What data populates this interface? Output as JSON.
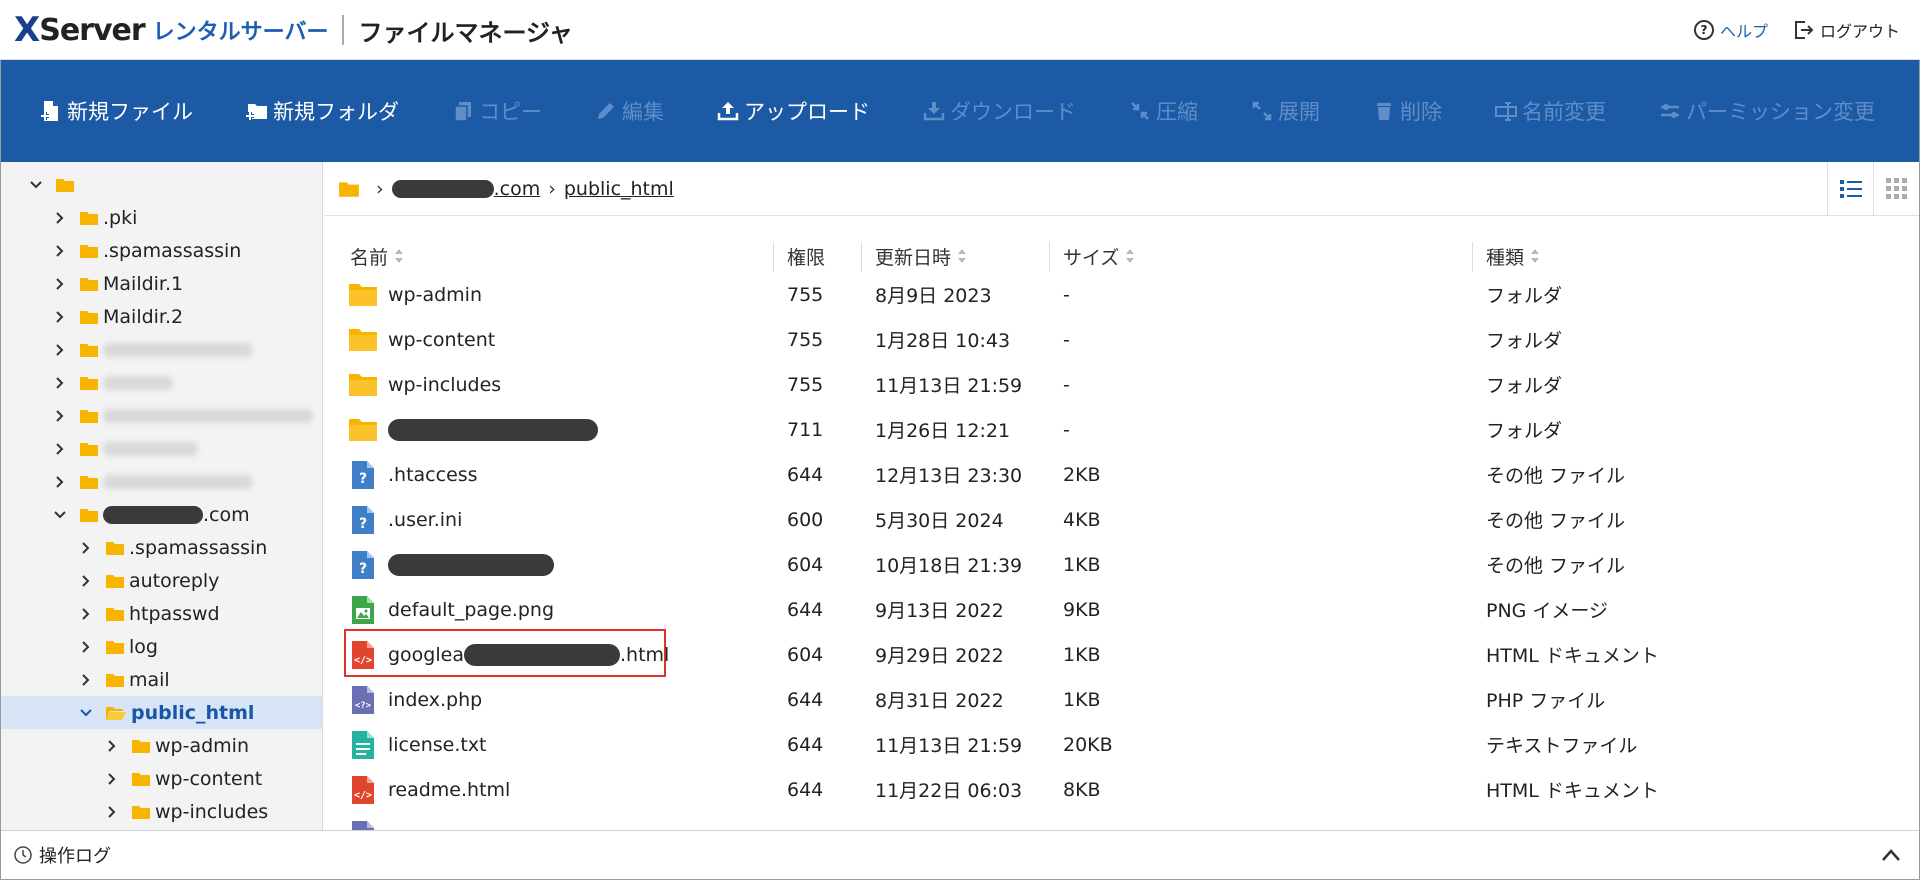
{
  "header": {
    "brand_x": "X",
    "brand_server": "Server",
    "brand_sub": "レンタルサーバー",
    "app_title": "ファイルマネージャ",
    "help_label": "ヘルプ",
    "logout_label": "ログアウト"
  },
  "toolbar": {
    "new_file": "新規ファイル",
    "new_folder": "新規フォルダ",
    "copy": "コピー",
    "edit": "編集",
    "upload": "アップロード",
    "download": "ダウンロード",
    "compress": "圧縮",
    "extract": "展開",
    "delete": "削除",
    "rename": "名前変更",
    "permission": "パーミッション変更"
  },
  "sidebar": {
    "items": [
      {
        "label": ".pki"
      },
      {
        "label": ".spamassassin"
      },
      {
        "label": "Maildir.1"
      },
      {
        "label": "Maildir.2"
      },
      {
        "label": ".com"
      },
      {
        "label": ".spamassassin"
      },
      {
        "label": "autoreply"
      },
      {
        "label": "htpasswd"
      },
      {
        "label": "log"
      },
      {
        "label": "mail"
      },
      {
        "label": "public_html"
      },
      {
        "label": "wp-admin"
      },
      {
        "label": "wp-content"
      },
      {
        "label": "wp-includes"
      }
    ]
  },
  "breadcrumb": {
    "domain_suffix": ".com",
    "current": "public_html"
  },
  "table": {
    "headers": {
      "name": "名前",
      "perm": "権限",
      "date": "更新日時",
      "size": "サイズ",
      "type": "種類"
    },
    "rows": [
      {
        "name": "wp-admin",
        "perm": "755",
        "date": "8月9日 2023",
        "size": "-",
        "type": "フォルダ"
      },
      {
        "name": "wp-content",
        "perm": "755",
        "date": "1月28日 10:43",
        "size": "-",
        "type": "フォルダ"
      },
      {
        "name": "wp-includes",
        "perm": "755",
        "date": "11月13日 21:59",
        "size": "-",
        "type": "フォルダ"
      },
      {
        "name": "",
        "perm": "711",
        "date": "1月26日 12:21",
        "size": "-",
        "type": "フォルダ"
      },
      {
        "name": ".htaccess",
        "perm": "644",
        "date": "12月13日 23:30",
        "size": "2KB",
        "type": "その他 ファイル"
      },
      {
        "name": ".user.ini",
        "perm": "600",
        "date": "5月30日 2024",
        "size": "4KB",
        "type": "その他 ファイル"
      },
      {
        "name": "",
        "perm": "604",
        "date": "10月18日 21:39",
        "size": "1KB",
        "type": "その他 ファイル"
      },
      {
        "name": "default_page.png",
        "perm": "644",
        "date": "9月13日 2022",
        "size": "9KB",
        "type": "PNG イメージ"
      },
      {
        "name_prefix": "googlea",
        "name_suffix": ".html",
        "perm": "604",
        "date": "9月29日 2022",
        "size": "1KB",
        "type": "HTML ドキュメント"
      },
      {
        "name": "index.php",
        "perm": "644",
        "date": "8月31日 2022",
        "size": "1KB",
        "type": "PHP ファイル"
      },
      {
        "name": "license.txt",
        "perm": "644",
        "date": "11月13日 21:59",
        "size": "20KB",
        "type": "テキストファイル"
      },
      {
        "name": "readme.html",
        "perm": "644",
        "date": "11月22日 06:03",
        "size": "8KB",
        "type": "HTML ドキュメント"
      }
    ]
  },
  "bottom": {
    "log_label": "操作ログ"
  },
  "colors": {
    "toolbar_bg": "#1c5aa6",
    "toolbar_disabled": "#5f8dc8",
    "folder": "#f7b500",
    "highlight": "#e0312b"
  }
}
